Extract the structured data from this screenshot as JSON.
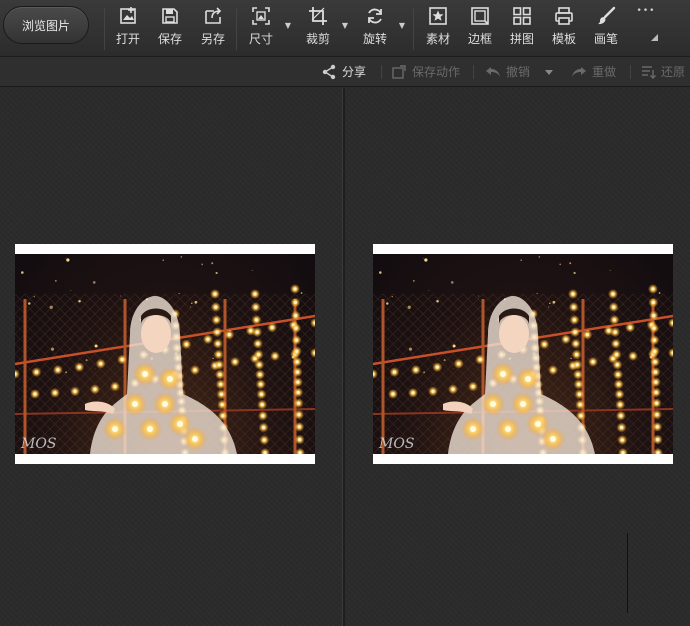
{
  "toolbar": {
    "browse_label": "浏览图片",
    "tools": {
      "open": "打开",
      "save": "保存",
      "save_as": "另存",
      "size": "尺寸",
      "crop": "裁剪",
      "rotate": "旋转",
      "material": "素材",
      "border": "边框",
      "collage": "拼图",
      "template": "模板",
      "brush": "画笔"
    },
    "more": "•••"
  },
  "actions": {
    "share": "分享",
    "save_action": "保存动作",
    "undo": "撤销",
    "redo": "重做",
    "restore": "还原"
  },
  "watermark": "MOS"
}
